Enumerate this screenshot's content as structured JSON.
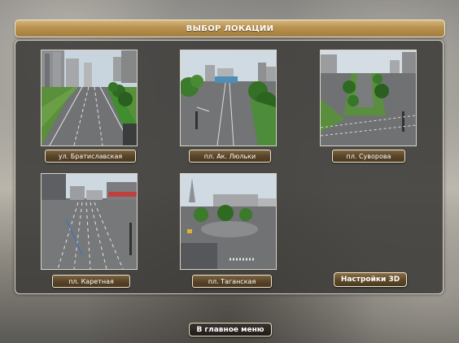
{
  "header": {
    "title": "ВЫБОР ЛОКАЦИИ"
  },
  "locations": [
    {
      "label": "ул. Братиславская"
    },
    {
      "label": "пл. Ак. Люльки"
    },
    {
      "label": "пл. Суворова"
    },
    {
      "label": "пл. Каретная"
    },
    {
      "label": "пл. Таганская"
    }
  ],
  "buttons": {
    "settings_3d": "Настройки 3D",
    "main_menu": "В главное меню"
  },
  "colors": {
    "accent_gold": "#b8914f",
    "button_brown": "#5a4528",
    "panel_bg": "#3e3c3a"
  }
}
